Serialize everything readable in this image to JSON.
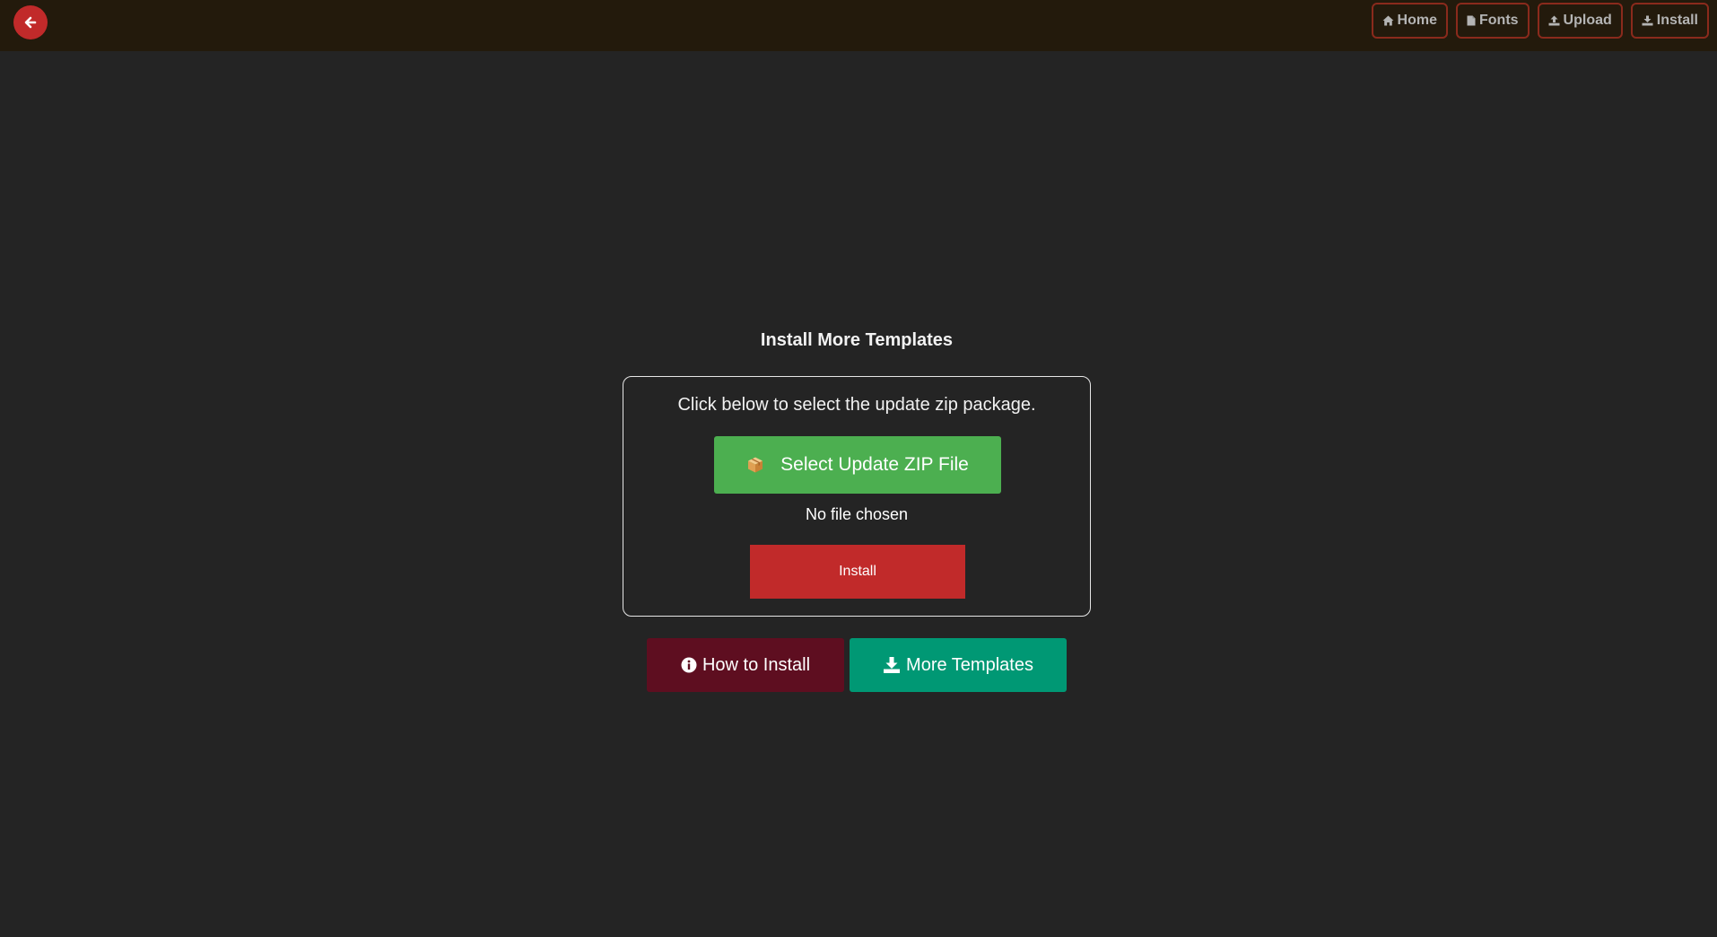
{
  "colors": {
    "background": "#242424",
    "topbar": "#231a0c",
    "back_button": "#c12a2a",
    "nav_border": "#8a2a1c",
    "select_button": "#4caf50",
    "install_button": "#c12a2a",
    "how_to_button": "#5e0e20",
    "more_templates_button": "#009874"
  },
  "topbar": {
    "back_icon": "arrow-left-icon",
    "nav": [
      {
        "label": "Home",
        "icon": "home-icon"
      },
      {
        "label": "Fonts",
        "icon": "file-icon"
      },
      {
        "label": "Upload",
        "icon": "upload-icon"
      },
      {
        "label": "Install",
        "icon": "download-icon"
      }
    ]
  },
  "main": {
    "title": "Install More Templates",
    "card": {
      "instruction": "Click below to select the update zip package.",
      "select_button": {
        "label": "Select Update ZIP File",
        "icon": "package-icon"
      },
      "file_status": "No file chosen",
      "install_button": "Install"
    },
    "how_to_button": {
      "label": "How to Install",
      "icon": "info-icon"
    },
    "more_templates_button": {
      "label": "More Templates",
      "icon": "download-icon"
    }
  }
}
